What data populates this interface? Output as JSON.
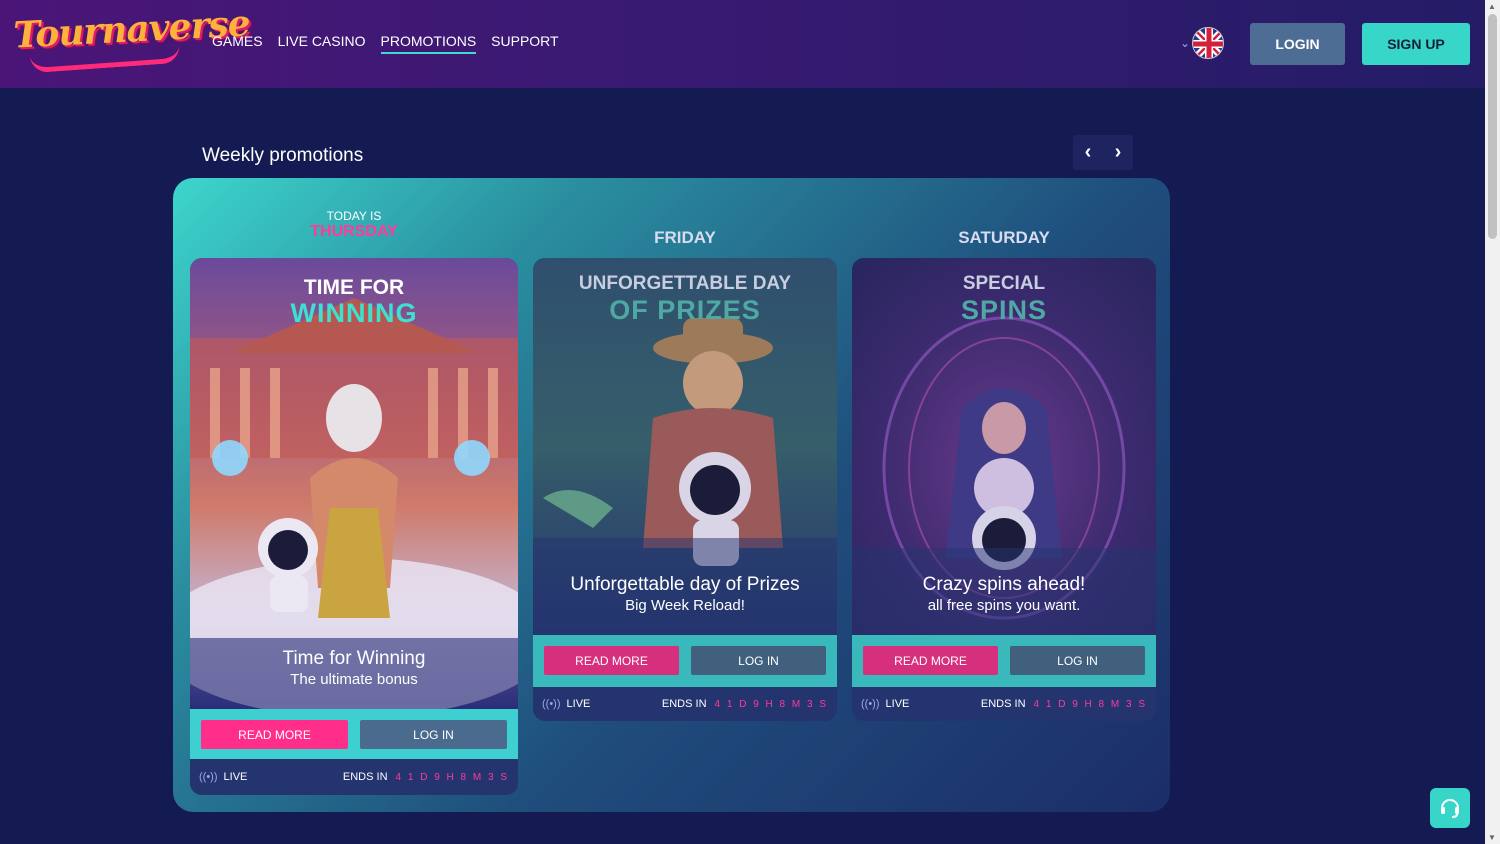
{
  "header": {
    "logo_text": "Tournaverse",
    "nav": [
      {
        "label": "GAMES"
      },
      {
        "label": "LIVE CASINO"
      },
      {
        "label": "PROMOTIONS"
      },
      {
        "label": "SUPPORT"
      }
    ],
    "language": "uk-flag-icon",
    "login_label": "LOGIN",
    "signup_label": "SIGN UP"
  },
  "section": {
    "title": "Weekly promotions",
    "prev_icon": "chevron-left-icon",
    "next_icon": "chevron-right-icon"
  },
  "days": [
    {
      "today_label": "TODAY IS",
      "day": "THURSDAY",
      "image_title_top": "TIME FOR",
      "image_title_bottom": "WINNING",
      "subtitle": "Time for Winning",
      "description": "The ultimate bonus",
      "read_more": "READ MORE",
      "log_in": "LOG IN",
      "live_label": "LIVE",
      "ends_label": "ENDS IN",
      "timer": "4 1 D 9 H 8 M 3 S"
    },
    {
      "day": "FRIDAY",
      "image_title_top": "UNFORGETTABLE DAY",
      "image_title_bottom": "OF PRIZES",
      "subtitle": "Unforgettable day of Prizes",
      "description": "Big Week Reload!",
      "read_more": "READ MORE",
      "log_in": "LOG IN",
      "live_label": "LIVE",
      "ends_label": "ENDS IN",
      "timer": "4 1 D 9 H 8 M 3 S"
    },
    {
      "day": "SATURDAY",
      "image_title_top": "SPECIAL",
      "image_title_bottom": "SPINS",
      "subtitle": "Crazy spins ahead!",
      "description": "all free spins you want.",
      "read_more": "READ MORE",
      "log_in": "LOG IN",
      "live_label": "LIVE",
      "ends_label": "ENDS IN",
      "timer": "4 1 D 9 H 8 M 3 S"
    }
  ],
  "colors": {
    "accent_teal": "#38d6c8",
    "accent_pink": "#ff2e8a",
    "background": "#141a52"
  },
  "chat_icon": "support-chat-icon"
}
